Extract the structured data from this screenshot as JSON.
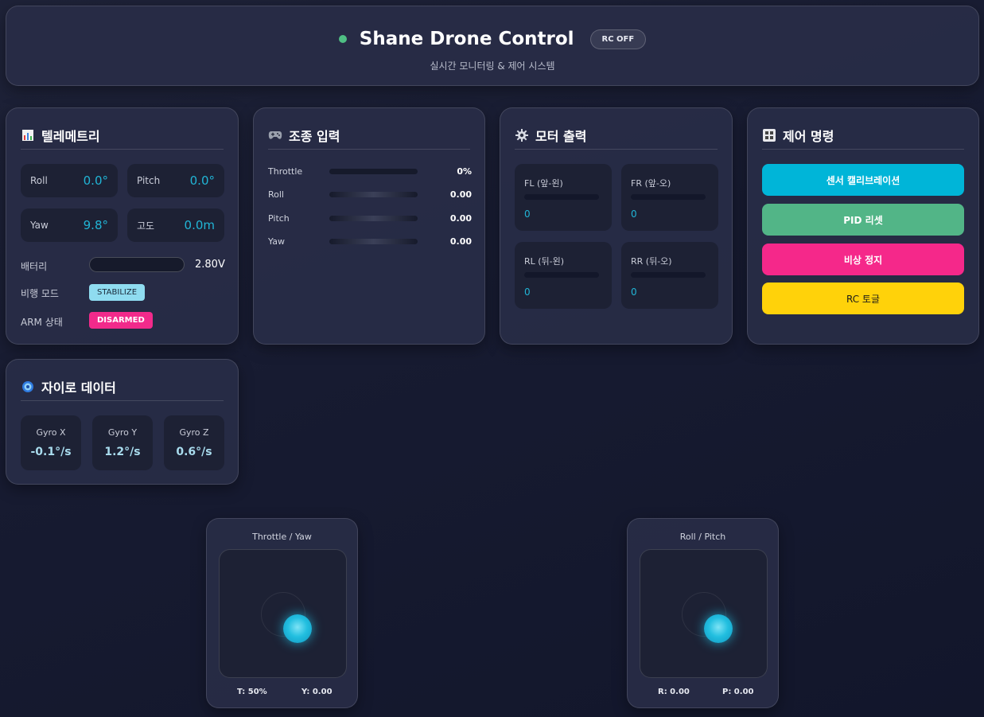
{
  "header": {
    "title": "Shane Drone Control",
    "rc_badge": "RC OFF",
    "subtitle": "실시간 모니터링 & 제어 시스템",
    "status_color": "#4fbf84"
  },
  "telemetry": {
    "title": "텔레메트리",
    "icon": "bar-chart-icon",
    "roll": {
      "label": "Roll",
      "value": "0.0°"
    },
    "pitch": {
      "label": "Pitch",
      "value": "0.0°"
    },
    "yaw": {
      "label": "Yaw",
      "value": "9.8°"
    },
    "altitude": {
      "label": "고도",
      "value": "0.0m"
    },
    "battery": {
      "label": "배터리",
      "value": "2.80V",
      "level": 0
    },
    "flight_mode": {
      "label": "비행 모드",
      "value": "STABILIZE"
    },
    "arm_state": {
      "label": "ARM 상태",
      "value": "DISARMED"
    }
  },
  "control_input": {
    "title": "조종 입력",
    "icon": "gamepad-icon",
    "rows": [
      {
        "label": "Throttle",
        "value": "0%"
      },
      {
        "label": "Roll",
        "value": "0.00"
      },
      {
        "label": "Pitch",
        "value": "0.00"
      },
      {
        "label": "Yaw",
        "value": "0.00"
      }
    ]
  },
  "motor_output": {
    "title": "모터 출력",
    "icon": "gear-icon",
    "motors": [
      {
        "label": "FL (앞-왼)",
        "value": "0"
      },
      {
        "label": "FR (앞-오)",
        "value": "0"
      },
      {
        "label": "RL (뒤-왼)",
        "value": "0"
      },
      {
        "label": "RR (뒤-오)",
        "value": "0"
      }
    ]
  },
  "commands": {
    "title": "제어 명령",
    "icon": "control-panel-icon",
    "buttons": [
      {
        "label": "센서 캘리브레이션",
        "color": "#00b5d8"
      },
      {
        "label": "PID 리셋",
        "color": "#52b587"
      },
      {
        "label": "비상 정지",
        "color": "#f5288a"
      },
      {
        "label": "RC 토글",
        "color": "#ffd20a"
      }
    ]
  },
  "gyro": {
    "title": "자이로 데이터",
    "icon": "gyro-icon",
    "axes": [
      {
        "label": "Gyro X",
        "value": "-0.1°/s"
      },
      {
        "label": "Gyro Y",
        "value": "1.2°/s"
      },
      {
        "label": "Gyro Z",
        "value": "0.6°/s"
      }
    ]
  },
  "joysticks": {
    "left": {
      "title": "Throttle / Yaw",
      "readout_a": "T: 50%",
      "readout_b": "Y: 0.00"
    },
    "right": {
      "title": "Roll / Pitch",
      "readout_a": "R: 0.00",
      "readout_b": "P: 0.00"
    }
  }
}
